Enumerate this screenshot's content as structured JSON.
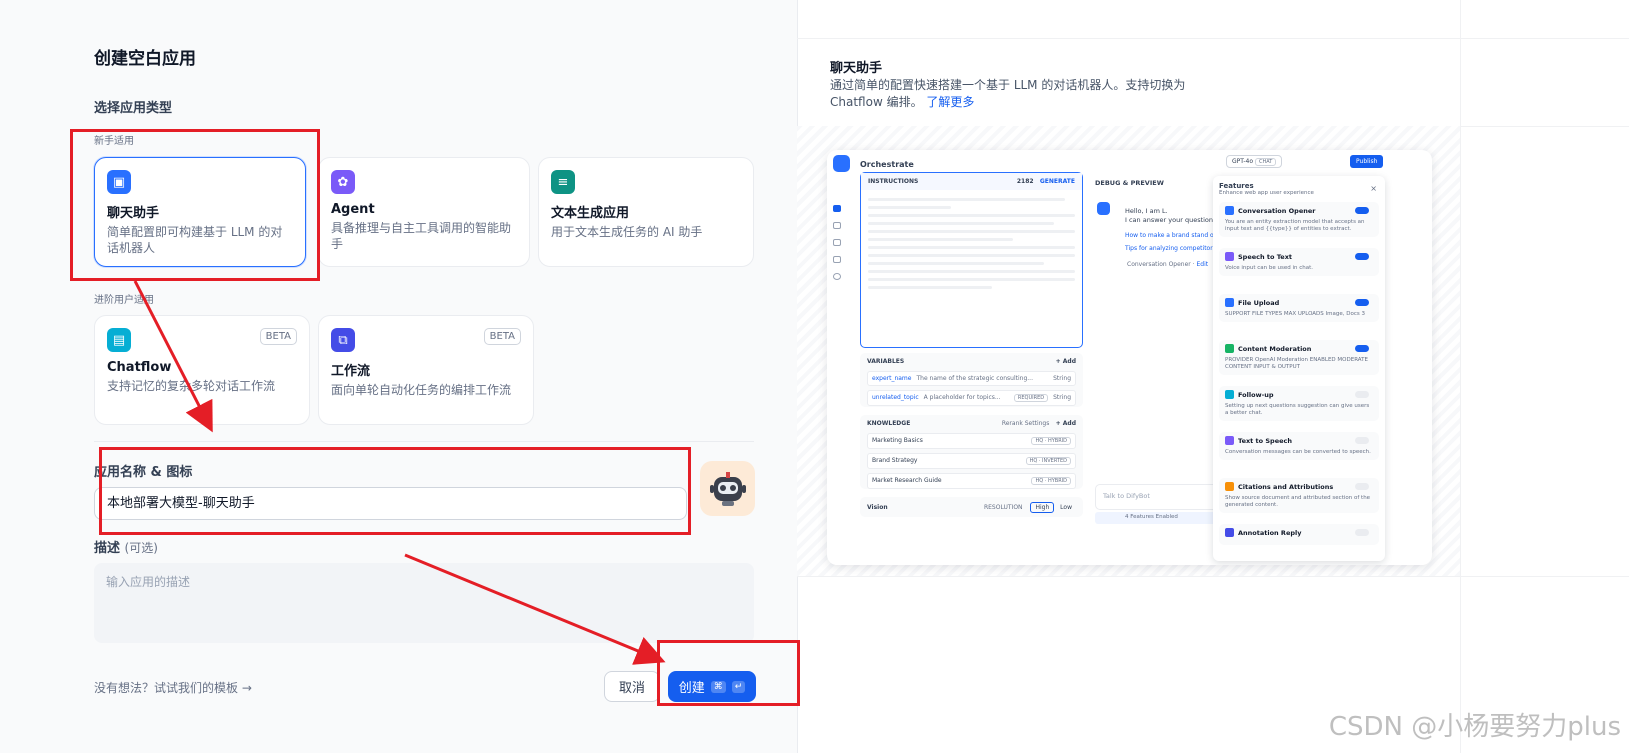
{
  "page_title": "创建空白应用",
  "app_type_section": "选择应用类型",
  "beginner_label": "新手适用",
  "advanced_label": "进阶用户适用",
  "cards": [
    {
      "name": "聊天助手",
      "desc": "简单配置即可构建基于 LLM 的对话机器人",
      "color": "#2970ff",
      "icon": "chat-bot-icon"
    },
    {
      "name": "Agent",
      "desc": "具备推理与自主工具调用的智能助手",
      "color": "#7a5af8",
      "icon": "agent-icon"
    },
    {
      "name": "文本生成应用",
      "desc": "用于文本生成任务的 AI 助手",
      "color": "#0e9384",
      "icon": "text-generation-icon"
    },
    {
      "name": "Chatflow",
      "desc": "支持记忆的复杂多轮对话工作流",
      "color": "#06aed4",
      "icon": "chatflow-icon",
      "badge": "BETA"
    },
    {
      "name": "工作流",
      "desc": "面向单轮自动化任务的编排工作流",
      "color": "#444ce7",
      "icon": "workflow-icon",
      "badge": "BETA"
    }
  ],
  "name_label": "应用名称 & 图标",
  "name_value": "本地部署大模型-聊天助手",
  "desc_label": "描述",
  "desc_optional": "(可选)",
  "desc_placeholder": "输入应用的描述",
  "template_link": "没有想法？试试我们的模板 →",
  "cancel": "取消",
  "create": "创建",
  "kbd_cmd": "⌘",
  "kbd_enter": "↵",
  "right_title": "聊天助手",
  "right_desc": "通过简单的配置快速搭建一个基于 LLM 的对话机器人。支持切换为 Chatflow 编排。",
  "right_link": "了解更多",
  "preview": {
    "header": "Orchestrate",
    "model": "GPT-4o",
    "model_tag": "CHAT",
    "publish": "Publish",
    "instructions": "INSTRUCTIONS",
    "count": "2182",
    "generate": "GENERATE",
    "debug": "DEBUG & PREVIEW",
    "hello": "Hello, I am L.",
    "answer": "I can answer your questions related",
    "q1": "How to make a brand stand out?",
    "q2": "Tips for analyzing competitors in market",
    "opener": "Conversation Opener",
    "edit": "Edit",
    "variables": "VARIABLES",
    "add": "+ Add",
    "var1_name": "expert_name",
    "var1_desc": "The name of the strategic consulting...",
    "var1_type": "String",
    "var2_name": "unrelated_topic",
    "var2_desc": "A placeholder for topics...",
    "var2_req": "REQUIRED",
    "var2_type": "String",
    "knowledge": "KNOWLEDGE",
    "rerank": "Rerank Settings",
    "kb": [
      {
        "name": "Marketing Basics",
        "tag": "HQ · HYBRID"
      },
      {
        "name": "Brand Strategy",
        "tag": "HQ · INVERTED"
      },
      {
        "name": "Market Research Guide",
        "tag": "HQ · HYBRID"
      }
    ],
    "vision": "Vision",
    "resolution": "RESOLUTION",
    "high": "High",
    "low": "Low",
    "talk": "Talk to DifyBot",
    "enabled": "4 Features Enabled",
    "features": "Features",
    "features_sub": "Enhance web app user experience",
    "feat": [
      {
        "name": "Conversation Opener",
        "desc": "You are an entity extraction model that accepts an input text and {{type}} of entities to extract.",
        "color": "#2970ff",
        "on": true
      },
      {
        "name": "Speech to Text",
        "desc": "Voice input can be used in chat.",
        "color": "#7a5af8",
        "on": true
      },
      {
        "name": "File Upload",
        "desc": "SUPPORT FILE TYPES   MAX UPLOADS  Image, Docs   3",
        "color": "#2970ff",
        "on": true
      },
      {
        "name": "Content Moderation",
        "desc": "PROVIDER  OpenAI Moderation   ENABLED MODERATE CONTENT  INPUT & OUTPUT",
        "color": "#16b364",
        "on": true
      },
      {
        "name": "Follow-up",
        "desc": "Setting up next questions suggestion can give users a better chat.",
        "color": "#06aed4",
        "on": false
      },
      {
        "name": "Text to Speech",
        "desc": "Conversation messages can be converted to speech.",
        "color": "#7a5af8",
        "on": false
      },
      {
        "name": "Citations and Attributions",
        "desc": "Show source document and attributed section of the generated content.",
        "color": "#f79009",
        "on": false
      },
      {
        "name": "Annotation Reply",
        "desc": "",
        "color": "#444ce7",
        "on": false
      }
    ]
  },
  "watermark": "CSDN @小杨要努力plus"
}
